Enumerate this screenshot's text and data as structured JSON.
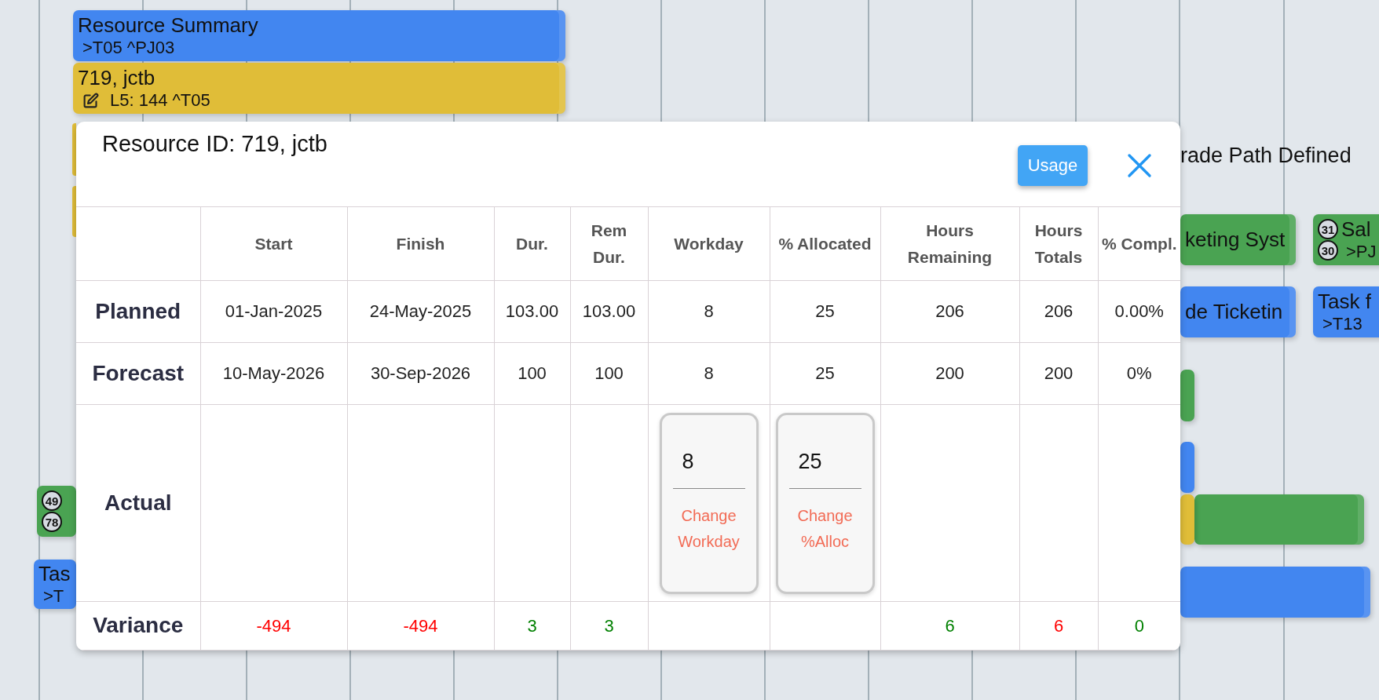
{
  "gantt": {
    "bars": [
      {
        "color": "#4286f0",
        "title": "Resource Summary",
        "subtitle": ">T05 ^PJ03"
      },
      {
        "color": "#e0bd38",
        "title": "719, jctb",
        "subtitle": "L5: 144 ^T05",
        "edit_icon": true
      },
      {
        "color": "#e0bd38"
      },
      {
        "color": "#e0bd38"
      },
      {
        "color": "#4aa352",
        "title": "keting Syst"
      },
      {
        "color": "#4aa352",
        "title": "Sal",
        "subtitle": ">PJ",
        "badges": [
          "31",
          "30"
        ]
      },
      {
        "color": "#4286f0",
        "title": "de Ticketin"
      },
      {
        "color": "#4286f0",
        "title": "Task f",
        "subtitle": ">T13"
      },
      {
        "color": "#4aa352"
      },
      {
        "color": "#4286f0"
      },
      {
        "color": "#4aa352"
      },
      {
        "color": "#e0bd38"
      },
      {
        "color": "#4286f0"
      },
      {
        "color": "#4aa352",
        "badges": [
          "49",
          "78"
        ]
      },
      {
        "color": "#4286f0",
        "title": "Tas",
        "subtitle": ">T"
      }
    ],
    "labels": [
      "rade Path Defined"
    ]
  },
  "dialog": {
    "title": "Resource ID: 719, jctb",
    "usage_button": "Usage",
    "columns": [
      "Start",
      "Finish",
      "Dur.",
      "Rem Dur.",
      "Workday",
      "% Allocated",
      "Hours Remaining",
      "Hours Totals",
      "% Compl."
    ],
    "rows": [
      {
        "label": "Planned",
        "cells": [
          {
            "text": "01-Jan-2025"
          },
          {
            "text": "24-May-2025"
          },
          {
            "text": "103.00"
          },
          {
            "text": "103.00"
          },
          {
            "text": "8"
          },
          {
            "text": "25"
          },
          {
            "text": "206"
          },
          {
            "text": "206"
          },
          {
            "text": "0.00%"
          }
        ]
      },
      {
        "label": "Forecast",
        "cells": [
          {
            "text": "10-May-2026"
          },
          {
            "text": "30-Sep-2026"
          },
          {
            "text": "100"
          },
          {
            "text": "100"
          },
          {
            "text": "8"
          },
          {
            "text": "25"
          },
          {
            "text": "200"
          },
          {
            "text": "200"
          },
          {
            "text": "0%"
          }
        ]
      },
      {
        "label": "Actual",
        "cells": [
          null,
          null,
          null,
          null,
          {
            "kind": "field",
            "value": "8",
            "label": "Change Workday"
          },
          {
            "kind": "field",
            "value": "25",
            "label": "Change %Alloc"
          },
          null,
          null,
          null
        ]
      },
      {
        "label": "Variance",
        "cells": [
          {
            "text": "-494",
            "color": "#ff0000"
          },
          {
            "text": "-494",
            "color": "#ff0000"
          },
          {
            "text": "3",
            "color": "#008000"
          },
          {
            "text": "3",
            "color": "#008000"
          },
          null,
          null,
          {
            "text": "6",
            "color": "#008000"
          },
          {
            "text": "6",
            "color": "#ff0000"
          },
          {
            "text": "0",
            "color": "#008000"
          }
        ]
      }
    ]
  }
}
